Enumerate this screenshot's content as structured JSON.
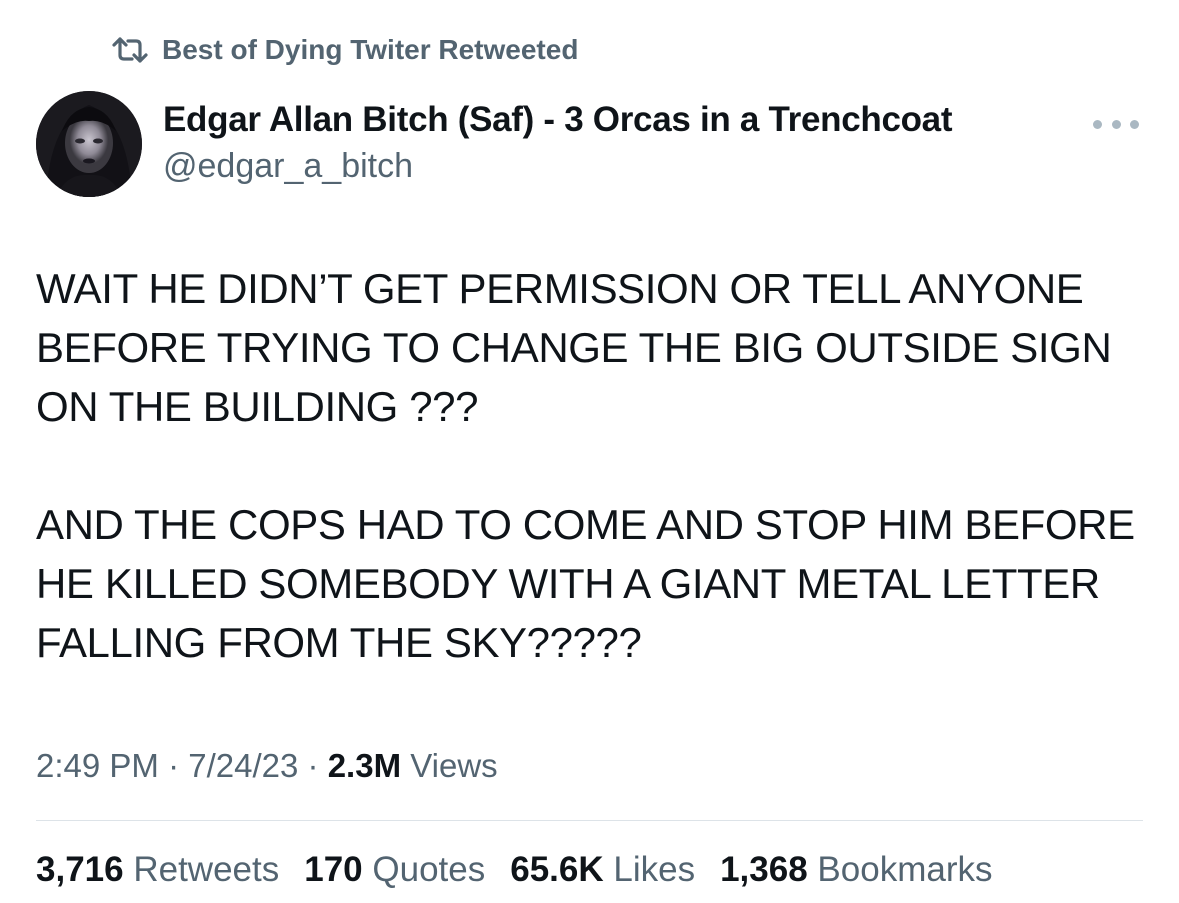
{
  "social_context": {
    "icon": "retweet-icon",
    "text": "Best of Dying Twiter Retweeted"
  },
  "author": {
    "display_name": "Edgar Allan Bitch (Saf) - 3 Orcas in a Trenchcoat",
    "handle": "@edgar_a_bitch"
  },
  "tweet": {
    "paragraphs": [
      [
        "WAIT HE DIDN’T GET PERMISSION OR TELL ANYONE",
        "BEFORE TRYING TO CHANGE THE BIG OUTSIDE SIGN",
        "ON THE BUILDING ???"
      ],
      [
        "AND THE COPS HAD TO COME AND STOP HIM BEFORE",
        "HE KILLED SOMEBODY WITH A GIANT METAL LETTER",
        "FALLING FROM THE SKY?????"
      ]
    ]
  },
  "meta": {
    "time": "2:49 PM",
    "separator": "·",
    "date": "7/24/23",
    "views_count": "2.3M",
    "views_label": "Views"
  },
  "stats": {
    "retweets": {
      "count": "3,716",
      "label": "Retweets"
    },
    "quotes": {
      "count": "170",
      "label": "Quotes"
    },
    "likes": {
      "count": "65.6K",
      "label": "Likes"
    },
    "bookmarks": {
      "count": "1,368",
      "label": "Bookmarks"
    }
  },
  "colors": {
    "text_primary": "#0f1419",
    "text_secondary": "#536471",
    "divider": "#dde3e8"
  }
}
